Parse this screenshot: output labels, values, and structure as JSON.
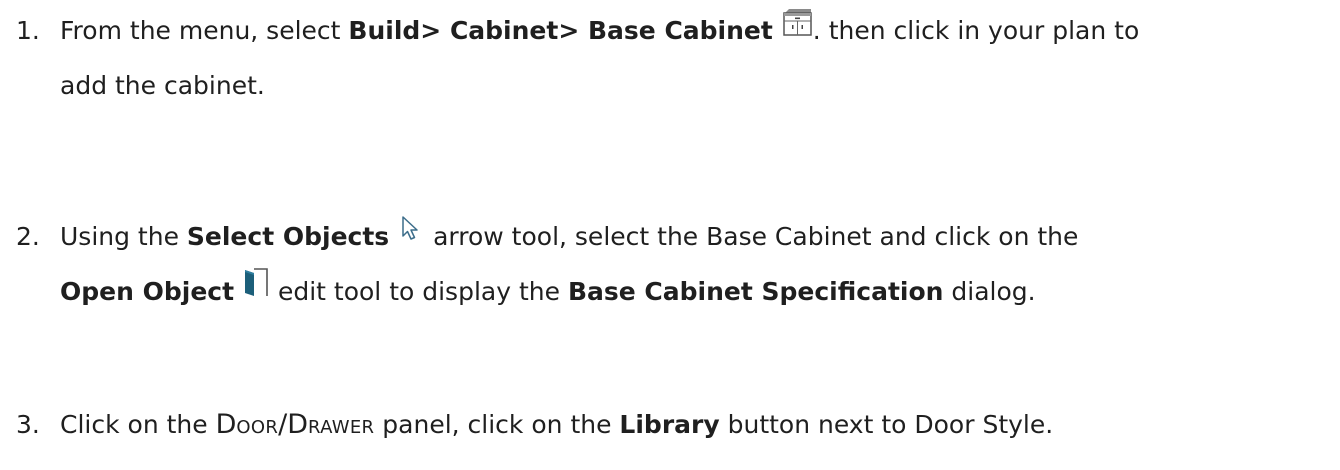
{
  "steps": [
    {
      "number": "1.",
      "text_a": "From the menu, select ",
      "bold_a": "Build> Cabinet> Base Cabinet",
      "icon_a": "base-cabinet-icon",
      "text_b": ". then click in your plan to",
      "text_c": "add the cabinet."
    },
    {
      "number": "2.",
      "text_a": "Using the ",
      "bold_a": "Select Objects",
      "icon_a": "select-arrow-icon",
      "text_b": " arrow tool, select the Base Cabinet and click on the",
      "bold_b": "Open Object",
      "icon_b": "open-object-icon",
      "text_c": " edit tool to display the ",
      "bold_c": "Base Cabinet Specification",
      "text_d": " dialog."
    },
    {
      "number": "3.",
      "text_a": "Click on the ",
      "sc_1_big": "D",
      "sc_1_small": "OOR",
      "sc_sep": "/",
      "sc_2_big": "D",
      "sc_2_small": "RAWER",
      "text_b": " panel, click on the ",
      "bold_a": "Library",
      "text_c": " button next to Door Style."
    }
  ],
  "colors": {
    "text": "#1f1f1f",
    "icon_accent": "#1c5f7a"
  }
}
